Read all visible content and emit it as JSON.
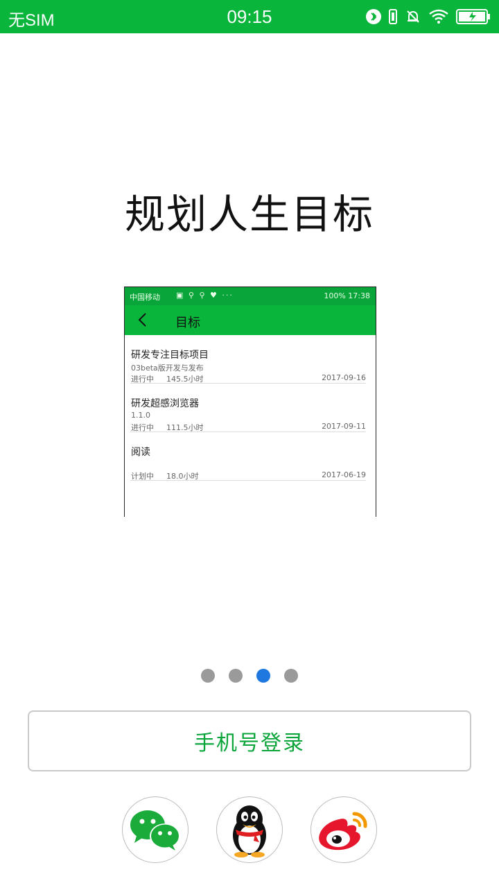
{
  "status_bar": {
    "carrier": "无SIM",
    "time": "09:15",
    "icons": [
      "bluetooth-icon",
      "vibrate-icon",
      "bell-off-icon",
      "wifi-icon",
      "battery-charging-icon"
    ]
  },
  "slide": {
    "headline": "规划人生目标",
    "preview": {
      "status_left": "中国移动",
      "status_right": "100%  17:38",
      "title": "目标",
      "items": [
        {
          "title": "研发专注目标项目",
          "subtitle": "03beta版开发与发布",
          "status": "进行中",
          "hours": "145.5小时",
          "date": "2017-09-16"
        },
        {
          "title": "研发超感浏览器",
          "subtitle": "1.1.0",
          "status": "进行中",
          "hours": "111.5小时",
          "date": "2017-09-11"
        },
        {
          "title": "阅读",
          "subtitle": "",
          "status": "计划中",
          "hours": "18.0小时",
          "date": "2017-06-19"
        }
      ]
    }
  },
  "pager": {
    "count": 4,
    "active_index": 2
  },
  "login": {
    "phone_button": "手机号登录"
  },
  "social": [
    {
      "name": "wechat-icon"
    },
    {
      "name": "qq-icon"
    },
    {
      "name": "weibo-icon"
    }
  ],
  "colors": {
    "brand_green": "#0ab53c",
    "active_dot": "#1e78e0",
    "inactive_dot": "#9a9a9a"
  }
}
